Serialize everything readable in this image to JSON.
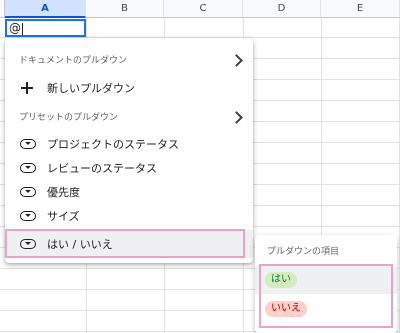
{
  "sheet": {
    "columns": [
      "A",
      "B",
      "C",
      "D",
      "E"
    ],
    "active_column": "A",
    "cell_input": "@"
  },
  "menu": {
    "section_document": "ドキュメントのプルダウン",
    "new_dropdown": "新しいプルダウン",
    "section_preset": "プリセットのプルダウン",
    "items": [
      {
        "label": "プロジェクトのステータス",
        "icon": "dropdown-chip-icon"
      },
      {
        "label": "レビューのステータス",
        "icon": "dropdown-chip-icon"
      },
      {
        "label": "優先度",
        "icon": "dropdown-chip-icon"
      },
      {
        "label": "サイズ",
        "icon": "dropdown-chip-icon"
      },
      {
        "label": "はい / いいえ",
        "icon": "dropdown-chip-icon"
      }
    ]
  },
  "submenu": {
    "title": "プルダウンの項目",
    "options": [
      {
        "label": "はい",
        "bg": "#d4edbc",
        "fg": "#11734b"
      },
      {
        "label": "いいえ",
        "bg": "#ffcfc9",
        "fg": "#b10202"
      }
    ]
  },
  "colors": {
    "highlight": "#e9a3c4",
    "active_border": "#1a73e8"
  }
}
